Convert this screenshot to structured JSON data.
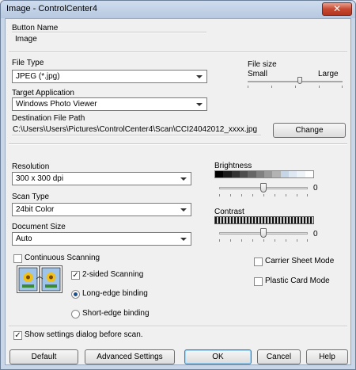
{
  "window": {
    "title": "Image - ControlCenter4",
    "close_glyph": "✕"
  },
  "button_name": {
    "label": "Button Name",
    "value": "Image"
  },
  "file_type": {
    "label": "File Type",
    "selected": "JPEG (*.jpg)"
  },
  "file_size": {
    "label": "File size",
    "small": "Small",
    "large": "Large",
    "level_percent": 55
  },
  "target_app": {
    "label": "Target Application",
    "selected": "Windows Photo Viewer"
  },
  "dest_path": {
    "label": "Destination File Path",
    "value": "C:\\Users\\Users\\Pictures\\ControlCenter4\\Scan\\CCI24042012_xxxx.jpg",
    "change_button": "Change"
  },
  "resolution": {
    "label": "Resolution",
    "selected": "300 x 300 dpi"
  },
  "scan_type": {
    "label": "Scan Type",
    "selected": "24bit Color"
  },
  "document_size": {
    "label": "Document Size",
    "selected": "Auto"
  },
  "brightness": {
    "label": "Brightness",
    "value": "0",
    "level_percent": 50
  },
  "contrast": {
    "label": "Contrast",
    "value": "0",
    "level_percent": 50
  },
  "continuous_scanning": {
    "label": "Continuous Scanning",
    "checked": false
  },
  "two_sided": {
    "label": "2-sided Scanning",
    "checked": true,
    "long_edge": "Long-edge binding",
    "short_edge": "Short-edge binding",
    "selected": "long"
  },
  "carrier_sheet": {
    "label": "Carrier Sheet Mode",
    "checked": false
  },
  "plastic_card": {
    "label": "Plastic Card Mode",
    "checked": false
  },
  "show_dialog": {
    "label": "Show settings dialog before scan.",
    "checked": true
  },
  "footer": {
    "default": "Default",
    "advanced": "Advanced Settings",
    "ok": "OK",
    "cancel": "Cancel",
    "help": "Help"
  },
  "check_glyph": "✓",
  "colors": {
    "title_gradient": "#b6c8e0",
    "close_red": "#c74830",
    "accent_blue": "#3c7fb1"
  }
}
